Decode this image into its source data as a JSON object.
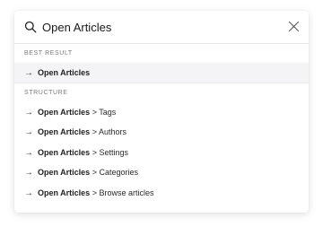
{
  "search": {
    "value": "Open Articles",
    "placeholder": ""
  },
  "sections": {
    "best_result": {
      "label": "BEST RESULT",
      "item": {
        "arrow": "→",
        "name": "Open Articles"
      }
    },
    "structure": {
      "label": "STRUCTURE",
      "items": [
        {
          "arrow": "→",
          "name": "Open Articles",
          "suffix": " > Tags"
        },
        {
          "arrow": "→",
          "name": "Open Articles",
          "suffix": " > Authors"
        },
        {
          "arrow": "→",
          "name": "Open Articles",
          "suffix": " > Settings"
        },
        {
          "arrow": "→",
          "name": "Open Articles",
          "suffix": " > Categories"
        },
        {
          "arrow": "→",
          "name": "Open Articles",
          "suffix": " > Browse articles"
        }
      ]
    }
  },
  "icons": {
    "search": "search-icon",
    "close": "close-icon",
    "arrow": "arrow-right-icon"
  },
  "colors": {
    "highlight_bg": "#f4f4f6",
    "text": "#1f1f1f",
    "muted": "#7a7a7a"
  }
}
